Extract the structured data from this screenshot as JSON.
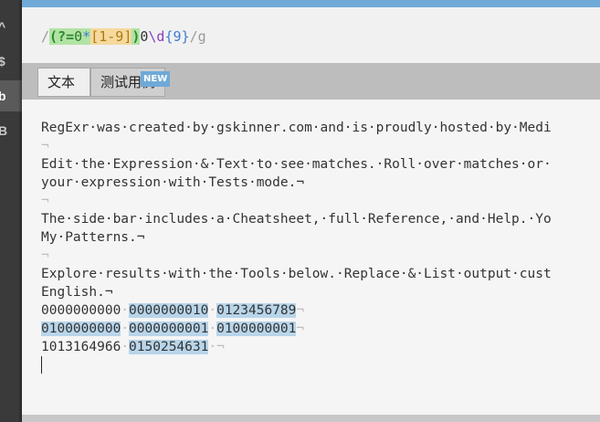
{
  "sidebar": {
    "items": [
      {
        "label": "^",
        "active": false
      },
      {
        "label": "$",
        "active": false
      },
      {
        "label": "b",
        "active": true
      },
      {
        "label": "B",
        "active": false
      }
    ]
  },
  "expression": {
    "open_delim": "/",
    "group_open": "(?=",
    "group_char": "0",
    "group_quant": "*",
    "set_open": "[",
    "set_range": "1-9",
    "set_close": "]",
    "group_close": ")",
    "literal": "0",
    "escape": "\\d",
    "quantifier": "{9}",
    "close_delim": "/",
    "flags": "g"
  },
  "tabs": [
    {
      "label": "文本",
      "active": true
    },
    {
      "label": "测试用例",
      "active": false
    }
  ],
  "new_badge": "NEW",
  "text_lines": [
    "RegExr·was·created·by·gskinner.com·and·is·proudly·hosted·by·Medi",
    "¬",
    "Edit·the·Expression·&·Text·to·see·matches.·Roll·over·matches·or·",
    "your·expression·with·Tests·mode.¬",
    "¬",
    "The·side·bar·includes·a·Cheatsheet,·full·Reference,·and·Help.·Yo",
    "My·Patterns.¬",
    "¬",
    "Explore·results·with·the·Tools·below.·Replace·&·List·output·cust",
    "English.¬"
  ],
  "number_rows": [
    {
      "first": "0000000000",
      "sep1": "·",
      "second": "0000000010",
      "sep2": "·",
      "third": "0123456789",
      "end": "¬"
    },
    {
      "first": "0100000000",
      "sep1": "·",
      "second": "0000000001",
      "sep2": "·",
      "third": "0100000001",
      "end": "¬"
    },
    {
      "first": "1013164966",
      "sep1": "·",
      "second": "0150254631",
      "sep2": "·",
      "third": "",
      "end": "¬"
    }
  ],
  "colors": {
    "accent": "#6fa9d8",
    "match_highlight": "#b8d5ea",
    "group_highlight": "#b2e3a5",
    "set_highlight": "#f5d99e"
  }
}
